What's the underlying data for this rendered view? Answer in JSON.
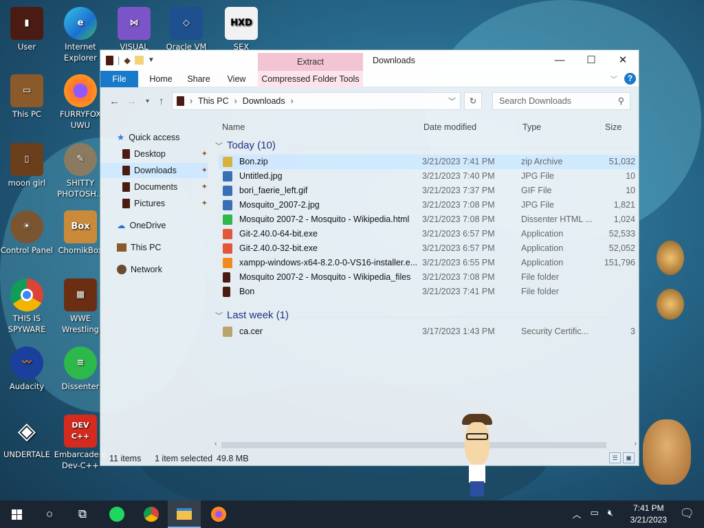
{
  "desktop": {
    "icons_left": [
      {
        "label": "User",
        "icon": "user-folder-icon"
      },
      {
        "label": "This PC",
        "icon": "computer-icon"
      },
      {
        "label": "moon girl",
        "icon": "book-icon"
      },
      {
        "label": "Control Panel",
        "icon": "control-panel-icon"
      },
      {
        "label": "THIS IS SPYWARE",
        "icon": "chrome-icon"
      },
      {
        "label": "Audacity",
        "icon": "audacity-icon"
      },
      {
        "label": "UNDERTALE",
        "icon": "unity-icon"
      }
    ],
    "icons_col2": [
      {
        "label": "Internet Explorer",
        "icon": "edge-icon"
      },
      {
        "label": "FURRYFOX UWU",
        "icon": "firefox-icon"
      },
      {
        "label": "SHITTY PHOTOSH...",
        "icon": "gimp-icon"
      },
      {
        "label": "ChomikBox",
        "icon": "chomikbox-icon"
      },
      {
        "label": "WWE Wrestling",
        "icon": "wrestling-icon"
      },
      {
        "label": "Dissenter",
        "icon": "dissenter-icon"
      },
      {
        "label": "Embarcadero Dev-C++",
        "icon": "devcpp-icon"
      }
    ],
    "icons_top": [
      {
        "label": "VISUAL",
        "icon": "visual-studio-icon"
      },
      {
        "label": "Oracle VM",
        "icon": "virtualbox-icon"
      },
      {
        "label": "SEX",
        "icon": "hxd-icon"
      }
    ]
  },
  "explorer": {
    "title": "Downloads",
    "context_tab": "Extract",
    "ribbon_tabs": [
      "File",
      "Home",
      "Share",
      "View",
      "Compressed Folder Tools"
    ],
    "breadcrumb": [
      "This PC",
      "Downloads"
    ],
    "search_placeholder": "Search Downloads",
    "nav": {
      "quick_access": "Quick access",
      "pinned": [
        "Desktop",
        "Downloads",
        "Documents",
        "Pictures"
      ],
      "onedrive": "OneDrive",
      "this_pc": "This PC",
      "network": "Network"
    },
    "columns": {
      "name": "Name",
      "date": "Date modified",
      "type": "Type",
      "size": "Size"
    },
    "groups": [
      {
        "label": "Today (10)",
        "files": [
          {
            "name": "Bon.zip",
            "date": "3/21/2023 7:41 PM",
            "type": "zip Archive",
            "size": "51,032",
            "icon": "zip-icon",
            "color": "#d9b23c",
            "selected": true
          },
          {
            "name": "Untitled.jpg",
            "date": "3/21/2023 7:40 PM",
            "type": "JPG File",
            "size": "10",
            "icon": "image-icon",
            "color": "#3a6fb5"
          },
          {
            "name": "bori_faerie_left.gif",
            "date": "3/21/2023 7:37 PM",
            "type": "GIF File",
            "size": "10",
            "icon": "image-icon",
            "color": "#3a6fb5"
          },
          {
            "name": "Mosquito_2007-2.jpg",
            "date": "3/21/2023 7:08 PM",
            "type": "JPG File",
            "size": "1,821",
            "icon": "image-icon",
            "color": "#3a6fb5"
          },
          {
            "name": "Mosquito 2007-2 - Mosquito - Wikipedia.html",
            "date": "3/21/2023 7:08 PM",
            "type": "Dissenter HTML ...",
            "size": "1,024",
            "icon": "dissenter-doc-icon",
            "color": "#2db84c"
          },
          {
            "name": "Git-2.40.0-64-bit.exe",
            "date": "3/21/2023 6:57 PM",
            "type": "Application",
            "size": "52,533",
            "icon": "git-icon",
            "color": "#e2563a"
          },
          {
            "name": "Git-2.40.0-32-bit.exe",
            "date": "3/21/2023 6:57 PM",
            "type": "Application",
            "size": "52,052",
            "icon": "git-icon",
            "color": "#e2563a"
          },
          {
            "name": "xampp-windows-x64-8.2.0-0-VS16-installer.e...",
            "date": "3/21/2023 6:55 PM",
            "type": "Application",
            "size": "151,796",
            "icon": "xampp-icon",
            "color": "#f28a1f"
          },
          {
            "name": "Mosquito 2007-2 - Mosquito - Wikipedia_files",
            "date": "3/21/2023 7:08 PM",
            "type": "File folder",
            "size": "",
            "icon": "folder-icon",
            "color": "#4a1b12"
          },
          {
            "name": "Bon",
            "date": "3/21/2023 7:41 PM",
            "type": "File folder",
            "size": "",
            "icon": "folder-icon",
            "color": "#4a1b12"
          }
        ]
      },
      {
        "label": "Last week (1)",
        "files": [
          {
            "name": "ca.cer",
            "date": "3/17/2023 1:43 PM",
            "type": "Security Certific...",
            "size": "3",
            "icon": "certificate-icon",
            "color": "#b9a46a"
          }
        ]
      }
    ],
    "status": {
      "count": "11 items",
      "selected": "1 item selected",
      "size": "49.8 MB"
    }
  },
  "taskbar": {
    "time": "7:41 PM",
    "date": "3/21/2023",
    "apps": [
      "windows-start-icon",
      "search-circle-icon",
      "task-view-icon",
      "spotify-icon",
      "chrome-icon",
      "file-explorer-icon",
      "firefox-icon"
    ]
  },
  "colors": {
    "accent": "#1979ca",
    "taskbar": "#1b2531",
    "selection": "#cde8ff"
  }
}
